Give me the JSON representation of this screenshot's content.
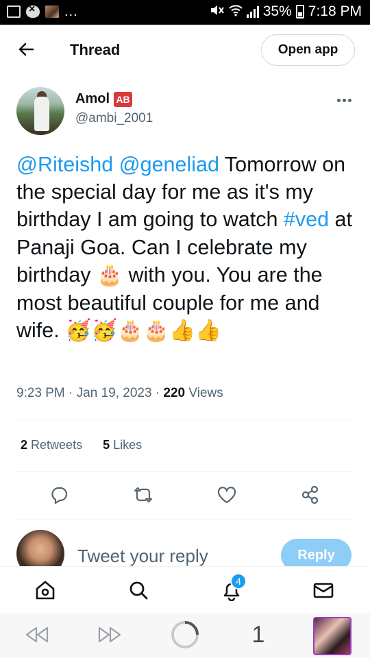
{
  "status_bar": {
    "left_icons": [
      "image-icon",
      "shield-icon",
      "photo-notification-icon"
    ],
    "overflow": "...",
    "battery": "35%",
    "time": "7:18 PM"
  },
  "header": {
    "title": "Thread",
    "open_app_label": "Open app"
  },
  "tweet": {
    "author_name": "Amol",
    "author_badge": "AB",
    "author_handle": "@ambi_2001",
    "text": {
      "mention1": "@Riteishd",
      "mention2": "@geneliad",
      "part1": " Tomorrow on the special day for me as it's my birthday I am going to watch ",
      "hashtag": "#ved",
      "part2": " at Panaji Goa. Can I celebrate my birthday ",
      "emoji_cake": "🎂",
      "part3": " with you. You are the most beautiful couple for me and wife. ",
      "emoji_tail": "🥳🥳🎂🎂👍👍"
    },
    "time": "9:23 PM",
    "separator": "·",
    "date": "Jan 19, 2023",
    "views_count": "220",
    "views_label": "Views",
    "retweets_count": "2",
    "retweets_label": "Retweets",
    "likes_count": "5",
    "likes_label": "Likes"
  },
  "reply_bar": {
    "placeholder": "Tweet your reply",
    "button_label": "Reply"
  },
  "bottom_nav": {
    "notification_count": "4"
  },
  "browser_bar": {
    "tab_count": "1"
  },
  "colors": {
    "link": "#1d9bf0",
    "text": "#0f1419",
    "secondary": "#536471",
    "reply_button": "#8ecdf8"
  }
}
